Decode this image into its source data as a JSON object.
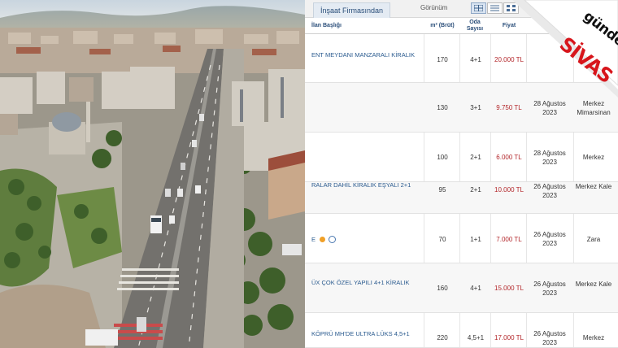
{
  "panel": {
    "tab_label": "İnşaat Firmasından",
    "view_label": "Görünüm",
    "view_buttons": [
      "grid-view-icon",
      "list-view-icon",
      "gallery-view-icon"
    ],
    "active_view": 0
  },
  "columns": {
    "title": "İlan Başlığı",
    "area": "m² (Brüt)",
    "rooms": "Oda Sayısı",
    "price": "Fiyat"
  },
  "rows": [
    {
      "title": "ENT MEYDANI MANZARALI KİRALIK",
      "area": "170",
      "rooms": "4+1",
      "price": "20.000 TL",
      "date": "",
      "location": ""
    },
    {
      "title": "",
      "area": "130",
      "rooms": "3+1",
      "price": "9.750 TL",
      "date": "28 Ağustos 2023",
      "location": "Merkez Mimarsinan"
    },
    {
      "title": "",
      "area": "100",
      "rooms": "2+1",
      "price": "6.000 TL",
      "date": "28 Ağustos 2023",
      "location": "Merkez"
    },
    {
      "title": "RALAR DAHİL KİRALIK EŞYALI 2+1",
      "area": "95",
      "rooms": "2+1",
      "price": "10.000 TL",
      "date": "26 Ağustos 2023",
      "location": "Merkez Kale"
    },
    {
      "title": "e",
      "area": "70",
      "rooms": "1+1",
      "price": "7.000 TL",
      "date": "26 Ağustos 2023",
      "location": "Zara"
    },
    {
      "title": "ÜX ÇOK ÖZEL YAPILI 4+1 KİRALIK",
      "area": "160",
      "rooms": "4+1",
      "price": "15.000 TL",
      "date": "26 Ağustos 2023",
      "location": "Merkez Kale"
    },
    {
      "title": "KÖPRÜ MH'DE ULTRA LÜKS 4,5+1",
      "area": "220",
      "rooms": "4,5+1",
      "price": "17.000 TL",
      "date": "26 Ağustos 2023",
      "location": "Merkez"
    }
  ],
  "brand": {
    "word_1": "gündem",
    "word_2": "SİVAS",
    "color_1": "#111111",
    "color_2": "#d7151b"
  },
  "colors": {
    "price": "#b3262a",
    "link": "#2b5b8f",
    "header": "#2b4f7a"
  }
}
